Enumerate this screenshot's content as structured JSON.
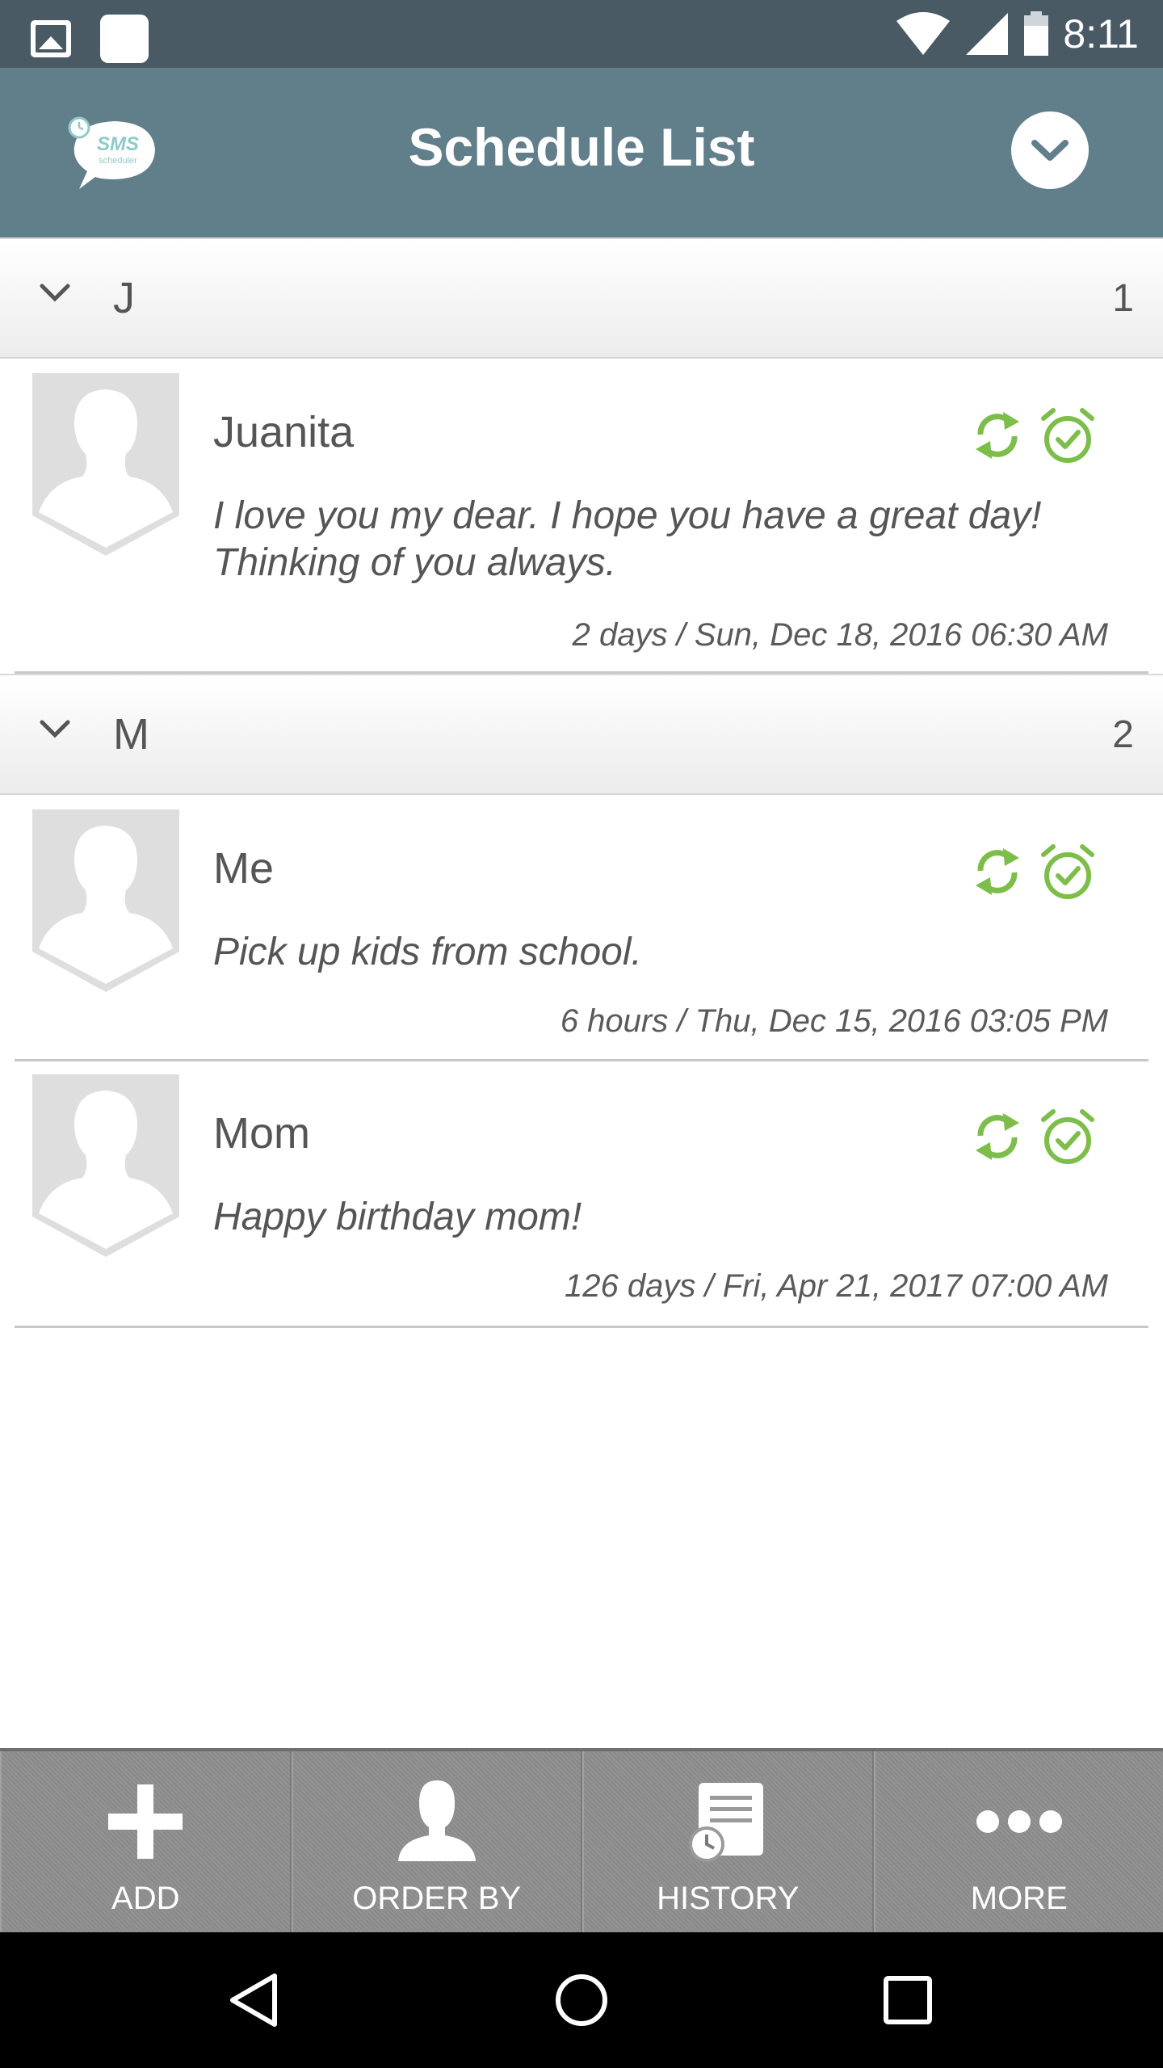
{
  "status_bar": {
    "time": "8:11"
  },
  "header": {
    "title": "Schedule List",
    "logo_text": "SMS",
    "logo_subtext": "scheduler"
  },
  "sections": [
    {
      "letter": "J",
      "count": "1"
    },
    {
      "letter": "M",
      "count": "2"
    }
  ],
  "items": [
    {
      "name": "Juanita",
      "message": "I love you my dear.  I hope you have a great day! Thinking of you always.",
      "time": "2 days / Sun, Dec 18, 2016  06:30 AM"
    },
    {
      "name": "Me",
      "message": "Pick up kids from school.",
      "time": "6 hours / Thu, Dec 15, 2016  03:05 PM"
    },
    {
      "name": "Mom",
      "message": "Happy birthday mom!",
      "time": "126 days / Fri, Apr 21, 2017  07:00 AM"
    }
  ],
  "toolbar": {
    "add_label": "ADD",
    "order_by_label": "ORDER BY",
    "history_label": "HISTORY",
    "more_label": "MORE"
  },
  "colors": {
    "header": "#617e8b",
    "status_bar": "#4a5a65",
    "accent_green": "#7dbe4a",
    "toolbar": "#8f8f8f"
  },
  "icons": {
    "status_left": [
      "image-icon",
      "app-square-icon"
    ],
    "status_right": [
      "wifi-icon",
      "signal-icon",
      "battery-icon"
    ],
    "item_icons": [
      "repeat-icon",
      "alarm-check-icon"
    ],
    "nav": [
      "back-icon",
      "home-icon",
      "recents-icon"
    ]
  }
}
